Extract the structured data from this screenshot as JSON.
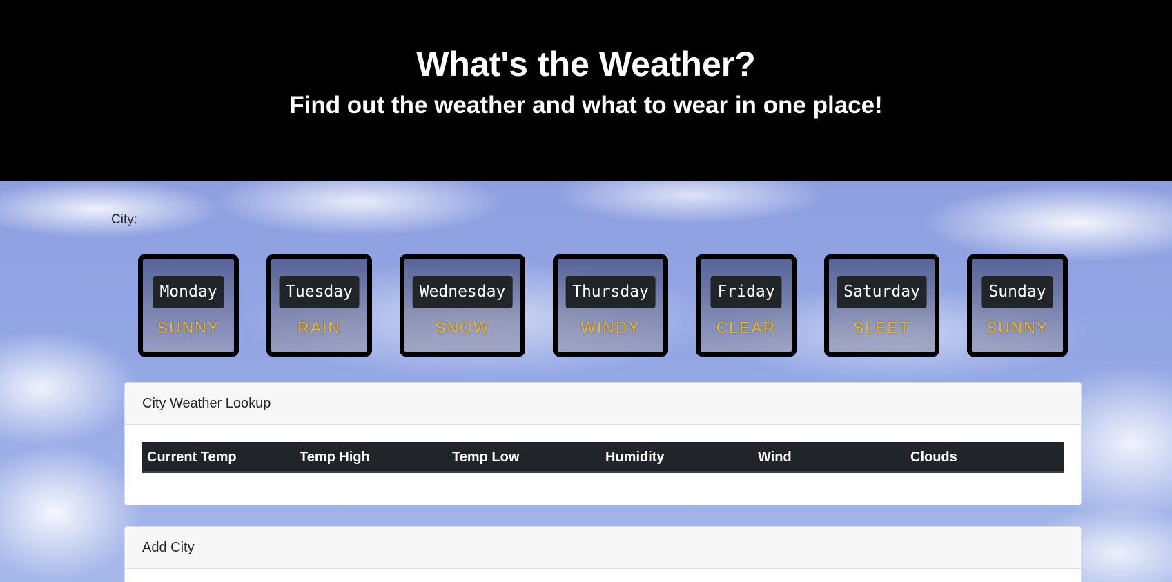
{
  "header": {
    "title": "What's the Weather?",
    "subtitle": "Find out the weather and what to wear in one place!"
  },
  "city": {
    "label": "City:"
  },
  "forecast": [
    {
      "day": "Monday",
      "weather": "SUNNY"
    },
    {
      "day": "Tuesday",
      "weather": "RAIN"
    },
    {
      "day": "Wednesday",
      "weather": "SNOW"
    },
    {
      "day": "Thursday",
      "weather": "WINDY"
    },
    {
      "day": "Friday",
      "weather": "CLEAR"
    },
    {
      "day": "Saturday",
      "weather": "SLEET"
    },
    {
      "day": "Sunday",
      "weather": "SUNNY"
    }
  ],
  "lookup": {
    "title": "City Weather Lookup",
    "columns": [
      "Current Temp",
      "Temp High",
      "Temp Low",
      "Humidity",
      "Wind",
      "Clouds"
    ]
  },
  "add_city": {
    "title": "Add City"
  },
  "colors": {
    "header_bg": "#000000",
    "weather_text": "#f0b429",
    "table_header_bg": "#212529"
  }
}
